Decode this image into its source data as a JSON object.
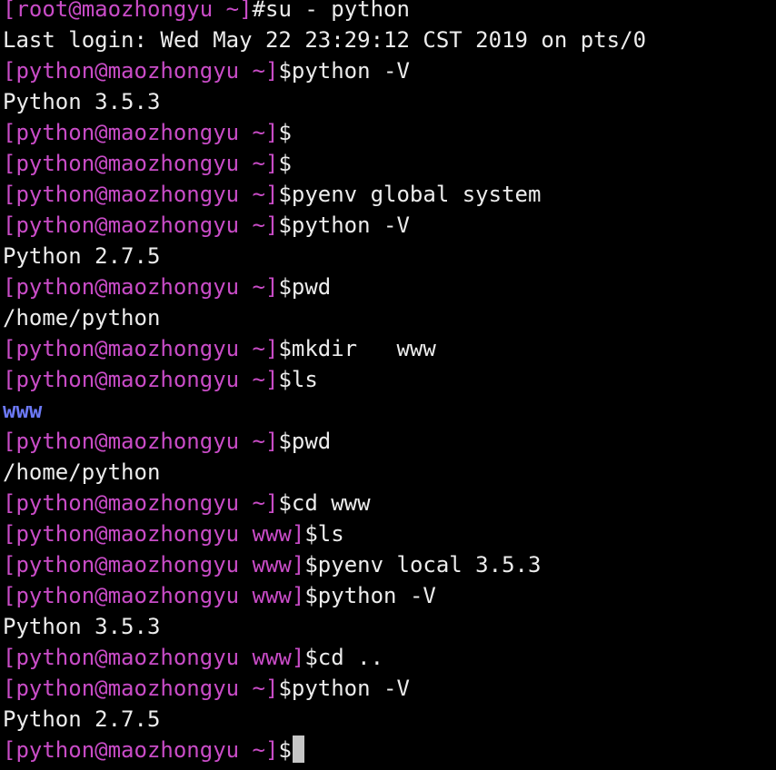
{
  "terminal": {
    "colors": {
      "background": "#000000",
      "prompt": "#c94cc7",
      "text": "#ececec",
      "directory": "#6c79f6",
      "cursor": "#c6c6c6"
    },
    "lines": [
      {
        "prompt": "[root@maozhongyu ~]",
        "command": "#su - python"
      },
      {
        "output": "Last login: Wed May 22 23:29:12 CST 2019 on pts/0"
      },
      {
        "prompt": "[python@maozhongyu ~]",
        "command": "$python -V"
      },
      {
        "output": "Python 3.5.3"
      },
      {
        "prompt": "[python@maozhongyu ~]",
        "command": "$"
      },
      {
        "prompt": "[python@maozhongyu ~]",
        "command": "$"
      },
      {
        "prompt": "[python@maozhongyu ~]",
        "command": "$pyenv global system"
      },
      {
        "prompt": "[python@maozhongyu ~]",
        "command": "$python -V"
      },
      {
        "output": "Python 2.7.5"
      },
      {
        "prompt": "[python@maozhongyu ~]",
        "command": "$pwd"
      },
      {
        "output": "/home/python"
      },
      {
        "prompt": "[python@maozhongyu ~]",
        "command": "$mkdir   www"
      },
      {
        "prompt": "[python@maozhongyu ~]",
        "command": "$ls"
      },
      {
        "directory": "www"
      },
      {
        "prompt": "[python@maozhongyu ~]",
        "command": "$pwd"
      },
      {
        "output": "/home/python"
      },
      {
        "prompt": "[python@maozhongyu ~]",
        "command": "$cd www"
      },
      {
        "prompt": "[python@maozhongyu www]",
        "command": "$ls"
      },
      {
        "prompt": "[python@maozhongyu www]",
        "command": "$pyenv local 3.5.3"
      },
      {
        "prompt": "[python@maozhongyu www]",
        "command": "$python -V"
      },
      {
        "output": "Python 3.5.3"
      },
      {
        "prompt": "[python@maozhongyu www]",
        "command": "$cd .."
      },
      {
        "prompt": "[python@maozhongyu ~]",
        "command": "$python -V"
      },
      {
        "output": "Python 2.7.5"
      },
      {
        "prompt": "[python@maozhongyu ~]",
        "command": "$",
        "cursor": true
      }
    ]
  }
}
